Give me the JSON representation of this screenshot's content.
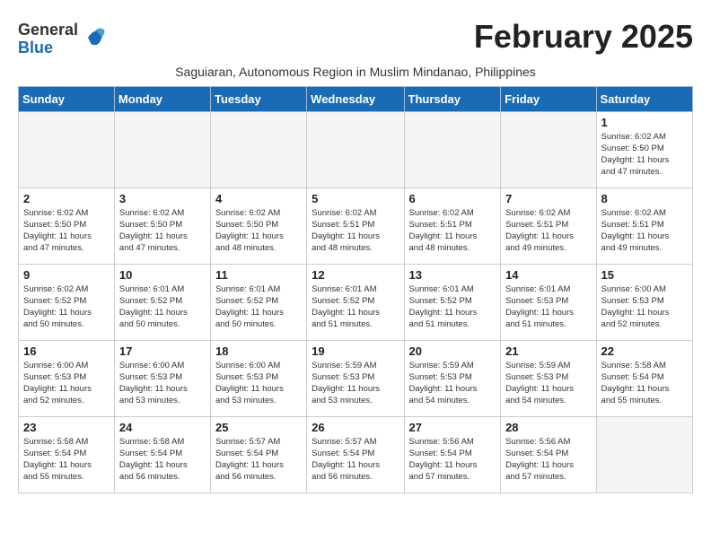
{
  "logo": {
    "general": "General",
    "blue": "Blue"
  },
  "title": "February 2025",
  "subtitle": "Saguiaran, Autonomous Region in Muslim Mindanao, Philippines",
  "days_of_week": [
    "Sunday",
    "Monday",
    "Tuesday",
    "Wednesday",
    "Thursday",
    "Friday",
    "Saturday"
  ],
  "weeks": [
    [
      {
        "day": "",
        "info": ""
      },
      {
        "day": "",
        "info": ""
      },
      {
        "day": "",
        "info": ""
      },
      {
        "day": "",
        "info": ""
      },
      {
        "day": "",
        "info": ""
      },
      {
        "day": "",
        "info": ""
      },
      {
        "day": "1",
        "info": "Sunrise: 6:02 AM\nSunset: 5:50 PM\nDaylight: 11 hours\nand 47 minutes."
      }
    ],
    [
      {
        "day": "2",
        "info": "Sunrise: 6:02 AM\nSunset: 5:50 PM\nDaylight: 11 hours\nand 47 minutes."
      },
      {
        "day": "3",
        "info": "Sunrise: 6:02 AM\nSunset: 5:50 PM\nDaylight: 11 hours\nand 47 minutes."
      },
      {
        "day": "4",
        "info": "Sunrise: 6:02 AM\nSunset: 5:50 PM\nDaylight: 11 hours\nand 48 minutes."
      },
      {
        "day": "5",
        "info": "Sunrise: 6:02 AM\nSunset: 5:51 PM\nDaylight: 11 hours\nand 48 minutes."
      },
      {
        "day": "6",
        "info": "Sunrise: 6:02 AM\nSunset: 5:51 PM\nDaylight: 11 hours\nand 48 minutes."
      },
      {
        "day": "7",
        "info": "Sunrise: 6:02 AM\nSunset: 5:51 PM\nDaylight: 11 hours\nand 49 minutes."
      },
      {
        "day": "8",
        "info": "Sunrise: 6:02 AM\nSunset: 5:51 PM\nDaylight: 11 hours\nand 49 minutes."
      }
    ],
    [
      {
        "day": "9",
        "info": "Sunrise: 6:02 AM\nSunset: 5:52 PM\nDaylight: 11 hours\nand 50 minutes."
      },
      {
        "day": "10",
        "info": "Sunrise: 6:01 AM\nSunset: 5:52 PM\nDaylight: 11 hours\nand 50 minutes."
      },
      {
        "day": "11",
        "info": "Sunrise: 6:01 AM\nSunset: 5:52 PM\nDaylight: 11 hours\nand 50 minutes."
      },
      {
        "day": "12",
        "info": "Sunrise: 6:01 AM\nSunset: 5:52 PM\nDaylight: 11 hours\nand 51 minutes."
      },
      {
        "day": "13",
        "info": "Sunrise: 6:01 AM\nSunset: 5:52 PM\nDaylight: 11 hours\nand 51 minutes."
      },
      {
        "day": "14",
        "info": "Sunrise: 6:01 AM\nSunset: 5:53 PM\nDaylight: 11 hours\nand 51 minutes."
      },
      {
        "day": "15",
        "info": "Sunrise: 6:00 AM\nSunset: 5:53 PM\nDaylight: 11 hours\nand 52 minutes."
      }
    ],
    [
      {
        "day": "16",
        "info": "Sunrise: 6:00 AM\nSunset: 5:53 PM\nDaylight: 11 hours\nand 52 minutes."
      },
      {
        "day": "17",
        "info": "Sunrise: 6:00 AM\nSunset: 5:53 PM\nDaylight: 11 hours\nand 53 minutes."
      },
      {
        "day": "18",
        "info": "Sunrise: 6:00 AM\nSunset: 5:53 PM\nDaylight: 11 hours\nand 53 minutes."
      },
      {
        "day": "19",
        "info": "Sunrise: 5:59 AM\nSunset: 5:53 PM\nDaylight: 11 hours\nand 53 minutes."
      },
      {
        "day": "20",
        "info": "Sunrise: 5:59 AM\nSunset: 5:53 PM\nDaylight: 11 hours\nand 54 minutes."
      },
      {
        "day": "21",
        "info": "Sunrise: 5:59 AM\nSunset: 5:53 PM\nDaylight: 11 hours\nand 54 minutes."
      },
      {
        "day": "22",
        "info": "Sunrise: 5:58 AM\nSunset: 5:54 PM\nDaylight: 11 hours\nand 55 minutes."
      }
    ],
    [
      {
        "day": "23",
        "info": "Sunrise: 5:58 AM\nSunset: 5:54 PM\nDaylight: 11 hours\nand 55 minutes."
      },
      {
        "day": "24",
        "info": "Sunrise: 5:58 AM\nSunset: 5:54 PM\nDaylight: 11 hours\nand 56 minutes."
      },
      {
        "day": "25",
        "info": "Sunrise: 5:57 AM\nSunset: 5:54 PM\nDaylight: 11 hours\nand 56 minutes."
      },
      {
        "day": "26",
        "info": "Sunrise: 5:57 AM\nSunset: 5:54 PM\nDaylight: 11 hours\nand 56 minutes."
      },
      {
        "day": "27",
        "info": "Sunrise: 5:56 AM\nSunset: 5:54 PM\nDaylight: 11 hours\nand 57 minutes."
      },
      {
        "day": "28",
        "info": "Sunrise: 5:56 AM\nSunset: 5:54 PM\nDaylight: 11 hours\nand 57 minutes."
      },
      {
        "day": "",
        "info": ""
      }
    ]
  ]
}
